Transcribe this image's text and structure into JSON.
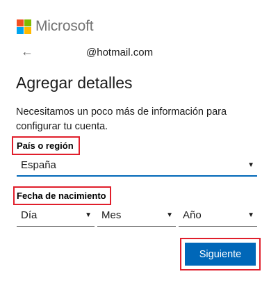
{
  "brand": {
    "name": "Microsoft",
    "logo_colors": [
      "#f25022",
      "#7fba00",
      "#00a4ef",
      "#ffb900"
    ]
  },
  "header": {
    "back_icon": "←",
    "identity": "@hotmail.com"
  },
  "title": "Agregar detalles",
  "description": "Necesitamos un poco más de información para configurar tu cuenta.",
  "country": {
    "label": "País o región",
    "value": "España"
  },
  "birthdate": {
    "label": "Fecha de nacimiento",
    "day_value": "Día",
    "month_value": "Mes",
    "year_value": "Año"
  },
  "caret_icon": "▼",
  "actions": {
    "next_label": "Siguiente"
  },
  "colors": {
    "accent": "#0067b8",
    "highlight": "#e01e2b"
  }
}
